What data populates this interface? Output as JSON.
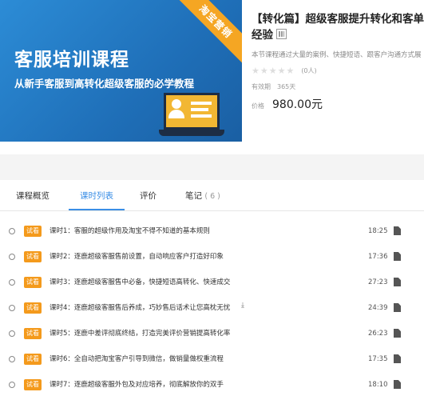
{
  "banner": {
    "title": "客服培训课程",
    "subtitle": "从新手客服到高转化超级客服的必学教程",
    "ribbon": "淘宝营销",
    "colors": {
      "bg": "#2c8cd6",
      "ribbon": "#f5a623",
      "laptop_screen": "#f2b733"
    }
  },
  "course": {
    "title_line1": "【转化篇】超级客服提升转化和客单",
    "title_line2": "经验",
    "description": "本节课程通过大量的案例、快捷短语、跟客户沟通方式展",
    "rating_count": "(0人)",
    "stars": "★★★★★",
    "valid_label": "有效期",
    "valid_value": "365天",
    "price_label": "价格",
    "price_value": "980.00元"
  },
  "tabs": [
    {
      "label": "课程概览"
    },
    {
      "label": "课时列表"
    },
    {
      "label": "评价"
    },
    {
      "label": "笔记",
      "count": "( 6 )"
    }
  ],
  "lesson_tag": "试看",
  "lessons": [
    {
      "title": "课时1：客服的超级作用及淘宝不得不知道的基本规则",
      "duration": "18:25"
    },
    {
      "title": "课时2：逐鹿超级客服售前设置，自动响应客户打造好印象",
      "duration": "17:36"
    },
    {
      "title": "课时3：逐鹿超级客服售中必备，快捷短语高转化、快速成交",
      "duration": "27:23"
    },
    {
      "title": "课时4：逐鹿超级客服售后养成，巧妙售后话术让您高枕无忧",
      "duration": "24:39"
    },
    {
      "title": "课时5：逐鹿中差评彻底终结，打造完美评价营销提高转化率",
      "duration": "26:23"
    },
    {
      "title": "课时6：全自动把淘宝客户引导到微信，做销量做权重流程",
      "duration": "17:35"
    },
    {
      "title": "课时7：逐鹿超级客服外包及对应培养，彻底解放你的双手",
      "duration": "18:10"
    }
  ],
  "accent_color": "#3a8ee6"
}
